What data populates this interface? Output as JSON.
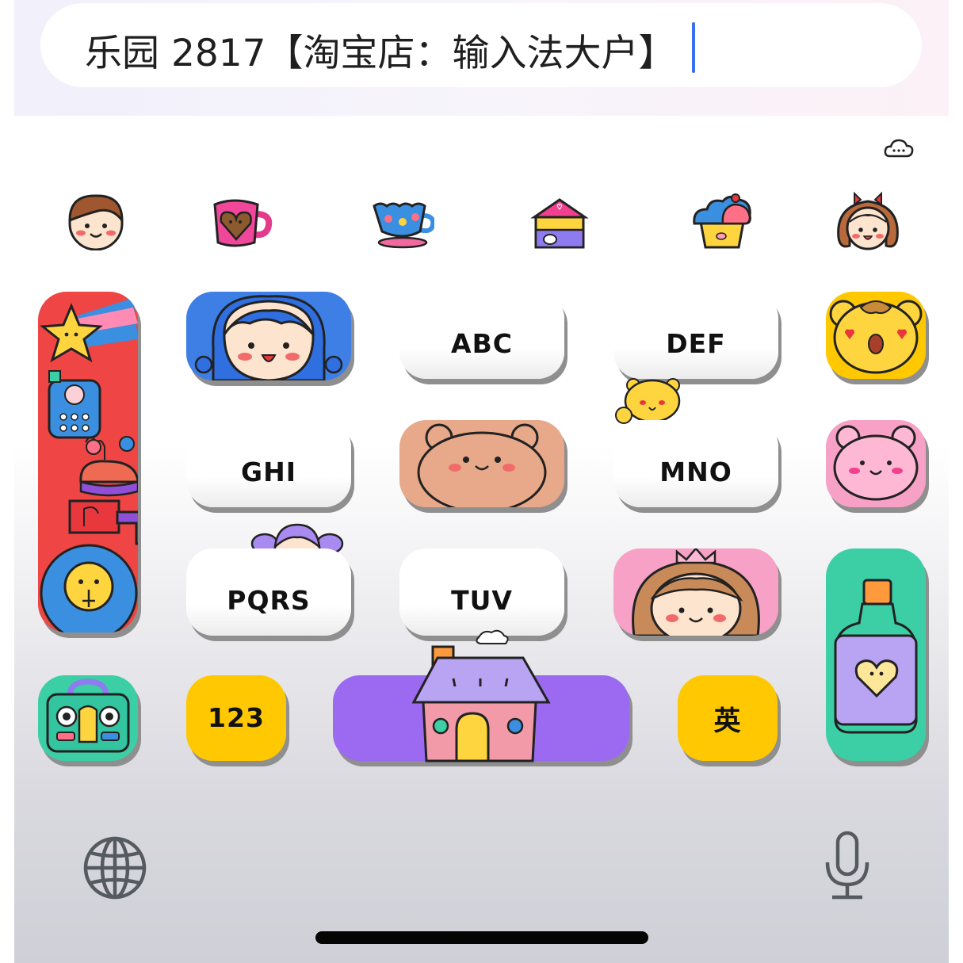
{
  "input": {
    "text": "乐园 2817【淘宝店：输入法大户】"
  },
  "toolbar": {
    "cloud_icon": "cloud-sync-icon",
    "stickers": [
      "boy-face-icon",
      "heart-mug-icon",
      "flower-teacup-icon",
      "milk-carton-house-icon",
      "cupcake-icon",
      "girl-face-icon"
    ]
  },
  "keys": {
    "abc": "ABC",
    "def": "DEF",
    "ghi": "GHI",
    "mno": "MNO",
    "pqrs": "PQRS",
    "tuv": "TUV",
    "num": "123",
    "lang": "英"
  },
  "bottom": {
    "globe_icon": "globe-icon",
    "mic_icon": "microphone-icon"
  },
  "colors": {
    "caret": "#3a6ff0",
    "blue_key": "#3e7fe6",
    "red_key": "#ef4545",
    "purple_space": "#9b6af0",
    "yellow_key": "#ffc800",
    "teal_key": "#3ccfa5",
    "pink_key": "#f7a1c6",
    "tan_key": "#e7a98a"
  }
}
